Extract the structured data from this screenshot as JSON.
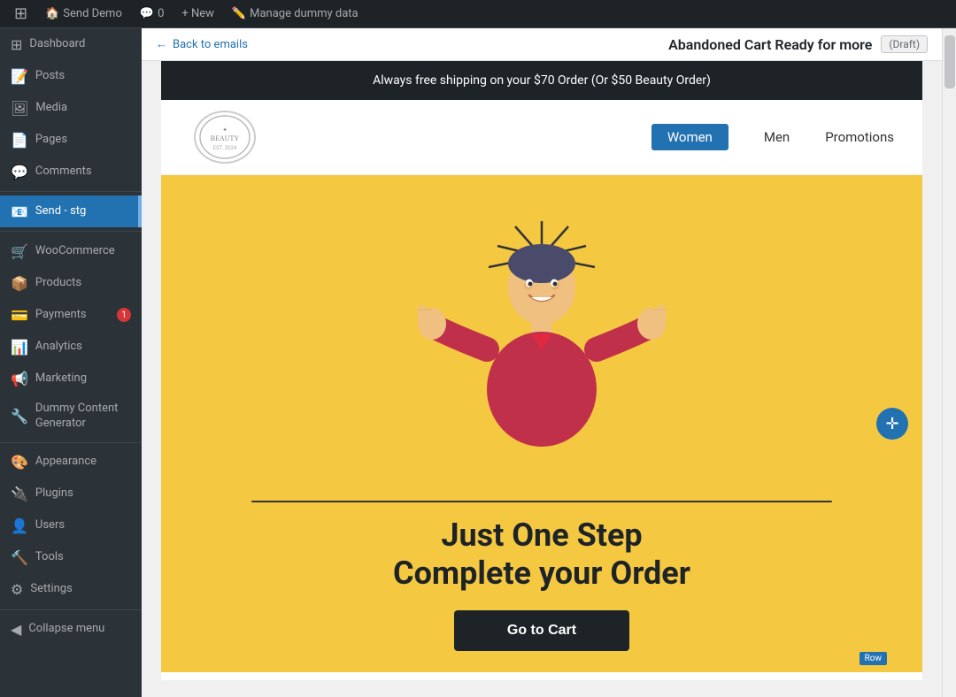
{
  "admin_bar": {
    "wp_logo": "⊞",
    "site_name": "Send Demo",
    "comments_icon": "💬",
    "comments_count": "0",
    "new_label": "+ New",
    "new_icon": "+",
    "manage_label": "Manage dummy data",
    "manage_icon": "✏️"
  },
  "sidebar": {
    "items": [
      {
        "id": "dashboard",
        "label": "Dashboard",
        "icon": "⊞"
      },
      {
        "id": "posts",
        "label": "Posts",
        "icon": "📝"
      },
      {
        "id": "media",
        "label": "Media",
        "icon": "🖼"
      },
      {
        "id": "pages",
        "label": "Pages",
        "icon": "📄"
      },
      {
        "id": "comments",
        "label": "Comments",
        "icon": "💬"
      },
      {
        "id": "send-stg",
        "label": "Send - stg",
        "icon": "📧",
        "active": true
      },
      {
        "id": "woocommerce",
        "label": "WooCommerce",
        "icon": "🛒"
      },
      {
        "id": "products",
        "label": "Products",
        "icon": "📦"
      },
      {
        "id": "payments",
        "label": "Payments",
        "icon": "💳",
        "badge": "1"
      },
      {
        "id": "analytics",
        "label": "Analytics",
        "icon": "📊"
      },
      {
        "id": "marketing",
        "label": "Marketing",
        "icon": "📢"
      },
      {
        "id": "dummy-content",
        "label": "Dummy Content Generator",
        "icon": "🔧"
      },
      {
        "id": "appearance",
        "label": "Appearance",
        "icon": "🎨"
      },
      {
        "id": "plugins",
        "label": "Plugins",
        "icon": "🔌"
      },
      {
        "id": "users",
        "label": "Users",
        "icon": "👤"
      },
      {
        "id": "tools",
        "label": "Tools",
        "icon": "🔨"
      },
      {
        "id": "settings",
        "label": "Settings",
        "icon": "⚙"
      }
    ],
    "collapse_label": "Collapse menu"
  },
  "page_header": {
    "back_label": "Back to emails",
    "title": "Abandoned Cart Ready for more",
    "draft_label": "(Draft)"
  },
  "email": {
    "banner_text": "Always free shipping on your $70 Order (Or $50 Beauty Order)",
    "logo_text": "BEAUTY",
    "logo_subtext": "EST. 2024",
    "nav_links": [
      {
        "label": "Women",
        "selected": true
      },
      {
        "label": "Men",
        "selected": false
      },
      {
        "label": "Promotions",
        "selected": false
      }
    ],
    "hero_line1": "Just One Step",
    "hero_line2": "Complete your Order",
    "cta_label": "Go to Cart",
    "row_tag": "Row"
  }
}
